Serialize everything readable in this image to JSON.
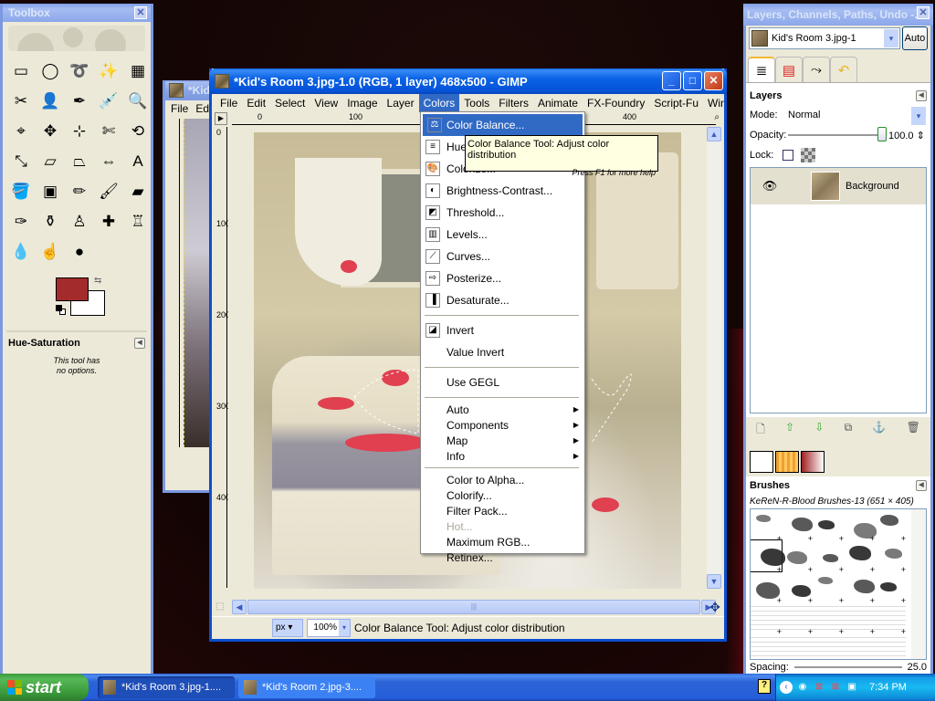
{
  "toolbox": {
    "title": "Toolbox",
    "tools": [
      {
        "name": "rect-select-icon",
        "glyph": "▭"
      },
      {
        "name": "ellipse-select-icon",
        "glyph": "◯"
      },
      {
        "name": "free-select-icon",
        "glyph": "➰"
      },
      {
        "name": "fuzzy-select-icon",
        "glyph": "✨"
      },
      {
        "name": "select-by-color-icon",
        "glyph": "▦"
      },
      {
        "name": "scissors-select-icon",
        "glyph": "✂"
      },
      {
        "name": "foreground-select-icon",
        "glyph": "👤"
      },
      {
        "name": "paths-icon",
        "glyph": "✒"
      },
      {
        "name": "color-picker-icon",
        "glyph": "💉"
      },
      {
        "name": "zoom-icon",
        "glyph": "🔍"
      },
      {
        "name": "measure-icon",
        "glyph": "⌖"
      },
      {
        "name": "move-icon",
        "glyph": "✥"
      },
      {
        "name": "alignment-icon",
        "glyph": "⊹"
      },
      {
        "name": "crop-icon",
        "glyph": "✄"
      },
      {
        "name": "rotate-icon",
        "glyph": "⟲"
      },
      {
        "name": "scale-icon",
        "glyph": "⤡"
      },
      {
        "name": "shear-icon",
        "glyph": "▱"
      },
      {
        "name": "perspective-icon",
        "glyph": "⏢"
      },
      {
        "name": "flip-icon",
        "glyph": "⇔"
      },
      {
        "name": "text-icon",
        "glyph": "A"
      },
      {
        "name": "bucket-fill-icon",
        "glyph": "🪣"
      },
      {
        "name": "blend-icon",
        "glyph": "▣"
      },
      {
        "name": "pencil-icon",
        "glyph": "✏"
      },
      {
        "name": "paintbrush-icon",
        "glyph": "🖌"
      },
      {
        "name": "eraser-icon",
        "glyph": "▰"
      },
      {
        "name": "airbrush-icon",
        "glyph": "✑"
      },
      {
        "name": "ink-icon",
        "glyph": "⚱"
      },
      {
        "name": "clone-icon",
        "glyph": "♙"
      },
      {
        "name": "heal-icon",
        "glyph": "✚"
      },
      {
        "name": "perspective-clone-icon",
        "glyph": "♖"
      },
      {
        "name": "blur-sharpen-icon",
        "glyph": "💧"
      },
      {
        "name": "smudge-icon",
        "glyph": "☝"
      },
      {
        "name": "dodge-burn-icon",
        "glyph": "●"
      }
    ],
    "fg_color": "#a42b2b",
    "bg_color": "#ffffff",
    "options_title": "Hue-Saturation",
    "options_note_1": "This tool has",
    "options_note_2": "no options."
  },
  "background_window": {
    "title": "*Kid",
    "menu_file": "File",
    "menu_edit": "Ed"
  },
  "gimp_window": {
    "title": "*Kid's Room 3.jpg-1.0 (RGB, 1 layer) 468x500 - GIMP",
    "menu": [
      "File",
      "Edit",
      "Select",
      "View",
      "Image",
      "Layer",
      "Colors",
      "Tools",
      "Filters",
      "Animate",
      "FX-Foundry",
      "Script-Fu",
      "Winc"
    ],
    "active_menu": "Colors",
    "ruler_h": [
      "0",
      "100",
      "400"
    ],
    "ruler_v": [
      "0",
      "100",
      "200",
      "300",
      "400"
    ],
    "unit": "px",
    "zoom": "100%",
    "status": "Color Balance Tool: Adjust color distribution"
  },
  "colors_menu": {
    "group1": [
      {
        "label": "Color Balance...",
        "icon": "color-balance-icon",
        "glyph": "⚖",
        "highlighted": true
      },
      {
        "label": "Hue-Saturation...",
        "icon": "hue-saturation-icon",
        "glyph": "≡"
      },
      {
        "label": "Colorize...",
        "icon": "colorize-icon",
        "glyph": "🎨"
      },
      {
        "label": "Brightness-Contrast...",
        "icon": "brightness-contrast-icon",
        "glyph": "◐"
      },
      {
        "label": "Threshold...",
        "icon": "threshold-icon",
        "glyph": "◩"
      },
      {
        "label": "Levels...",
        "icon": "levels-icon",
        "glyph": "▥"
      },
      {
        "label": "Curves...",
        "icon": "curves-icon",
        "glyph": "⟋"
      },
      {
        "label": "Posterize...",
        "icon": "posterize-icon",
        "glyph": "⇨"
      },
      {
        "label": "Desaturate...",
        "icon": "desaturate-icon",
        "glyph": "▐"
      }
    ],
    "group2": [
      {
        "label": "Invert",
        "icon": "invert-icon",
        "glyph": "◪"
      },
      {
        "label": "Value Invert"
      }
    ],
    "group3": [
      {
        "label": "Use GEGL"
      }
    ],
    "group4": [
      {
        "label": "Auto",
        "submenu": true
      },
      {
        "label": "Components",
        "submenu": true
      },
      {
        "label": "Map",
        "submenu": true
      },
      {
        "label": "Info",
        "submenu": true
      }
    ],
    "group5": [
      {
        "label": "Color to Alpha..."
      },
      {
        "label": "Colorify..."
      },
      {
        "label": "Filter Pack..."
      },
      {
        "label": "Hot...",
        "disabled": true
      },
      {
        "label": "Maximum RGB..."
      },
      {
        "label": "Retinex..."
      }
    ]
  },
  "tooltip": {
    "text": "Color Balance Tool: Adjust color distribution",
    "hint": "Press F1 for more help"
  },
  "dock": {
    "title": "Layers, Channels, Paths, Undo -...",
    "image": "Kid's Room 3.jpg-1",
    "auto_label": "Auto",
    "layers_title": "Layers",
    "mode_label": "Mode:",
    "mode_value": "Normal",
    "opacity_label": "Opacity:",
    "opacity_value": "100.0",
    "lock_label": "Lock:",
    "layers": [
      {
        "name": "Background",
        "visible": true
      }
    ],
    "brushes_title": "Brushes",
    "brush_name": "KeReN-R-Blood Brushes-13 (651 × 405)",
    "spacing_label": "Spacing:",
    "spacing_value": "25.0"
  },
  "taskbar": {
    "start": "start",
    "tasks": [
      "*Kid's Room 3.jpg-1....",
      "*Kid's Room 2.jpg-3...."
    ],
    "clock": "7:34 PM"
  }
}
